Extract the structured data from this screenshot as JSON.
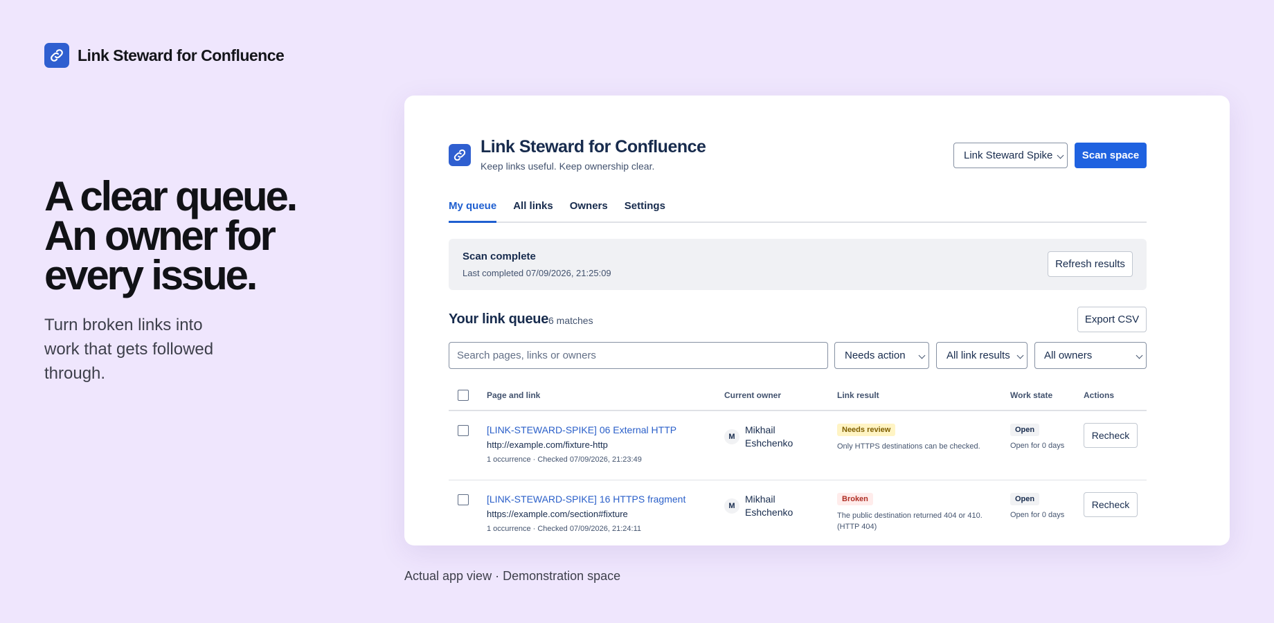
{
  "brand": {
    "name": "Link Steward for Confluence",
    "icon": "link-icon"
  },
  "hero": {
    "title_lines": [
      "A clear queue.",
      "An owner for",
      "every issue."
    ],
    "subtitle": "Turn broken links into work that gets followed through."
  },
  "app": {
    "title": "Link Steward for Confluence",
    "tagline": "Keep links useful. Keep ownership clear.",
    "space_select": "Link Steward Spike",
    "scan_button": "Scan space",
    "tabs": [
      "My queue",
      "All links",
      "Owners",
      "Settings"
    ],
    "active_tab": "My queue",
    "scan_status": {
      "title": "Scan complete",
      "subtitle": "Last completed 07/09/2026, 21:25:09",
      "refresh_button": "Refresh results"
    },
    "queue": {
      "title": "Your link queue",
      "count": "6 matches",
      "export_button": "Export CSV",
      "search_placeholder": "Search pages, links or owners",
      "filter_state": "Needs action",
      "filter_result": "All link results",
      "filter_owner": "All owners"
    },
    "table": {
      "headers": {
        "page": "Page and link",
        "owner": "Current owner",
        "result": "Link result",
        "state": "Work state",
        "actions": "Actions"
      },
      "rows": [
        {
          "page": "[LINK-STEWARD-SPIKE] 06 External HTTP",
          "url": "http://example.com/fixture-http",
          "meta": "1 occurrence · Checked 07/09/2026, 21:23:49",
          "avatar": "M",
          "owner": "Mikhail Eshchenko",
          "result_badge": "Needs review",
          "result_note": "Only HTTPS destinations can be checked.",
          "state": "Open",
          "state_note": "Open for 0 days",
          "action": "Recheck"
        },
        {
          "page": "[LINK-STEWARD-SPIKE] 16 HTTPS fragment",
          "url": "https://example.com/section#fixture",
          "meta": "1 occurrence · Checked 07/09/2026, 21:24:11",
          "avatar": "M",
          "owner": "Mikhail Eshchenko",
          "result_badge": "Broken",
          "result_note": "The public destination returned 404 or 410. (HTTP 404)",
          "state": "Open",
          "state_note": "Open for 0 days",
          "action": "Recheck"
        }
      ]
    }
  },
  "caption": "Actual app view · Demonstration space",
  "colors": {
    "background": "#efe6fd",
    "accent": "#1f62e0",
    "logo": "#2f5fd0"
  }
}
